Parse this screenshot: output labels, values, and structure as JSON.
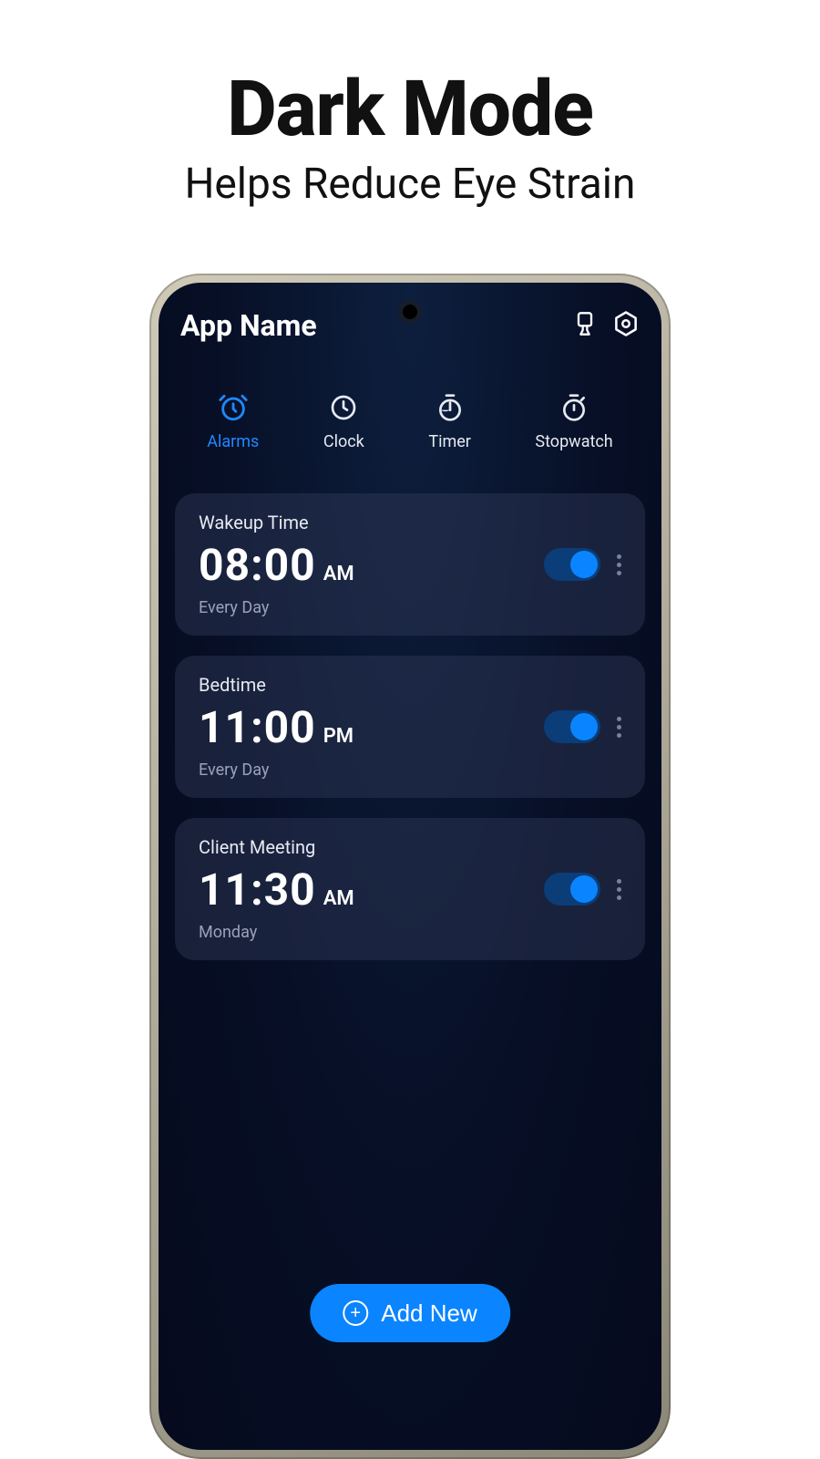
{
  "promo": {
    "title": "Dark Mode",
    "subtitle": "Helps Reduce Eye Strain"
  },
  "header": {
    "app_title": "App Name"
  },
  "tabs": [
    {
      "label": "Alarms",
      "active": true
    },
    {
      "label": "Clock",
      "active": false
    },
    {
      "label": "Timer",
      "active": false
    },
    {
      "label": "Stopwatch",
      "active": false
    }
  ],
  "alarms": [
    {
      "label": "Wakeup Time",
      "time": "08:00",
      "ampm": "AM",
      "repeat": "Every Day",
      "enabled": true
    },
    {
      "label": "Bedtime",
      "time": "11:00",
      "ampm": "PM",
      "repeat": "Every Day",
      "enabled": true
    },
    {
      "label": "Client Meeting",
      "time": "11:30",
      "ampm": "AM",
      "repeat": "Monday",
      "enabled": true
    }
  ],
  "add_button": {
    "label": "Add New"
  },
  "colors": {
    "accent": "#0a84ff",
    "card": "rgba(48,58,88,0.45)"
  }
}
